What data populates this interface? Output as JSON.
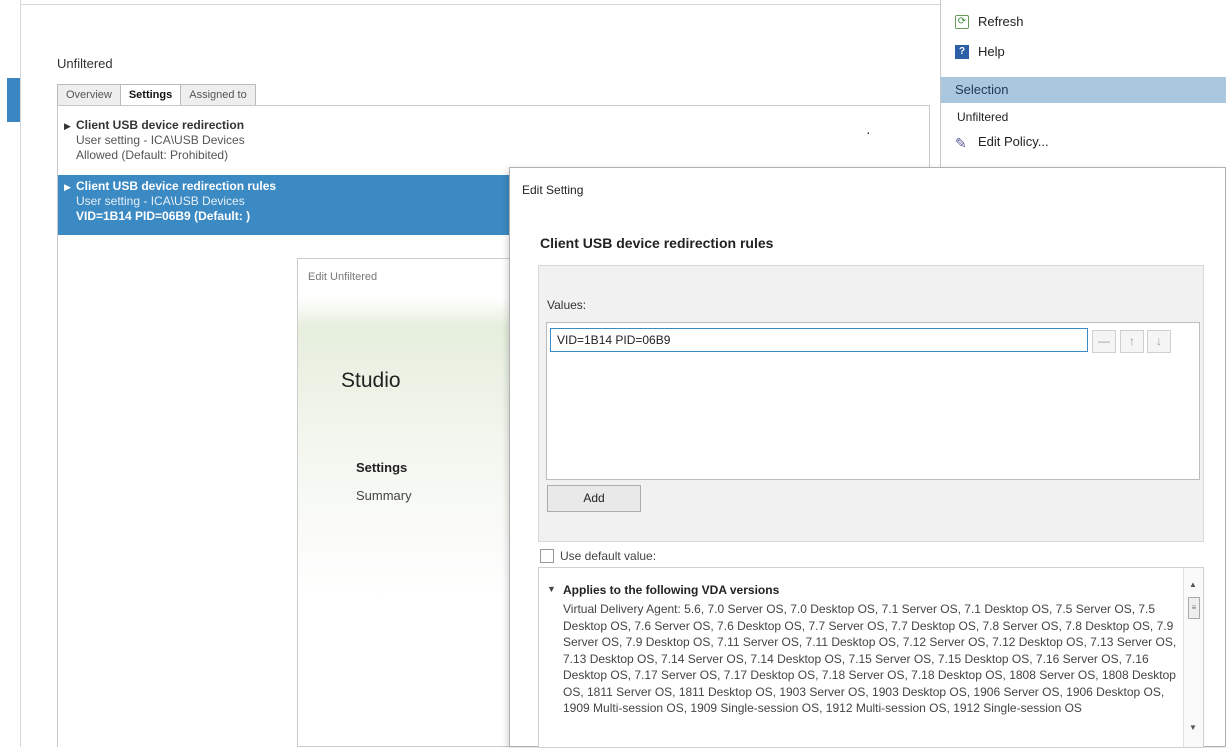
{
  "main": {
    "title": "Unfiltered",
    "tabs": [
      {
        "label": "Overview"
      },
      {
        "label": "Settings"
      },
      {
        "label": "Assigned to"
      }
    ],
    "settings": [
      {
        "name": "Client USB device redirection",
        "scope": "User setting - ICA\\USB Devices",
        "value": "Allowed (Default: Prohibited)"
      },
      {
        "name": "Client USB device redirection rules",
        "scope": "User setting - ICA\\USB Devices",
        "value": "VID=1B14 PID=06B9 (Default: )"
      }
    ]
  },
  "edit_unfiltered": {
    "title": "Edit Unfiltered",
    "app_name": "Studio",
    "nav": [
      {
        "label": "Settings"
      },
      {
        "label": "Summary"
      }
    ]
  },
  "action_pane": {
    "refresh_label": "Refresh",
    "help_label": "Help",
    "section_label": "Selection",
    "subheading": "Unfiltered",
    "edit_policy_label": "Edit Policy..."
  },
  "edit_setting": {
    "title": "Edit Setting",
    "heading": "Client USB device redirection rules",
    "values_label": "Values:",
    "value": "VID=1B14 PID=06B9",
    "remove_symbol": "—",
    "up_symbol": "↑",
    "down_symbol": "↓",
    "add_label": "Add",
    "use_default_label": "Use default value:",
    "applies_title": "Applies to the following VDA versions",
    "applies_text": "Virtual Delivery Agent: 5.6, 7.0 Server OS, 7.0 Desktop OS, 7.1 Server OS, 7.1 Desktop OS, 7.5 Server OS, 7.5 Desktop OS, 7.6 Server OS, 7.6 Desktop OS, 7.7 Server OS, 7.7 Desktop OS, 7.8 Server OS, 7.8 Desktop OS, 7.9 Server OS, 7.9 Desktop OS, 7.11 Server OS, 7.11 Desktop OS, 7.12 Server OS, 7.12 Desktop OS, 7.13 Server OS, 7.13 Desktop OS, 7.14 Server OS, 7.14 Desktop OS, 7.15 Server OS, 7.15 Desktop OS, 7.16 Server OS, 7.16 Desktop OS, 7.17 Server OS, 7.17 Desktop OS, 7.18 Server OS, 7.18 Desktop OS, 1808 Server OS, 1808 Desktop OS, 1811 Server OS, 1811 Desktop OS, 1903 Server OS, 1903 Desktop OS, 1906 Server OS, 1906 Desktop OS, 1909 Multi-session OS, 1909 Single-session OS, 1912 Multi-session OS, 1912 Single-session OS"
  },
  "colors": {
    "selection_blue": "#3c8ac3",
    "pane_header": "#a9c8e0"
  },
  "icons": [
    "refresh-icon",
    "help-icon",
    "edit-policy-icon",
    "expand-arrow-icon",
    "collapse-arrow-icon"
  ]
}
